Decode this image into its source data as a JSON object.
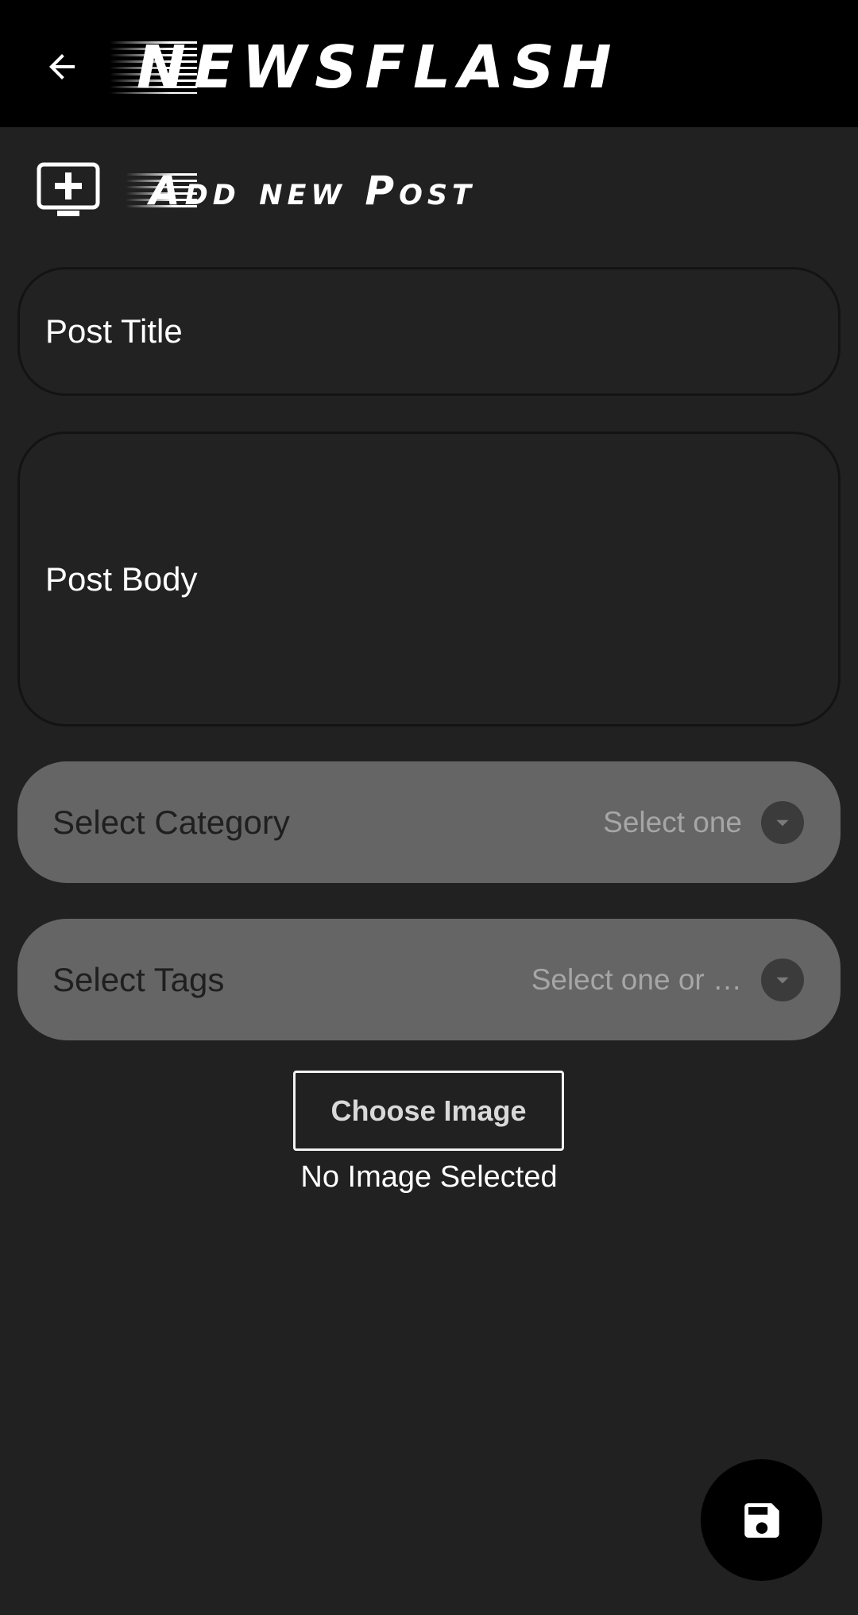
{
  "appbar": {
    "back_icon": "arrow-left-icon",
    "logo_text": "NEWSFLASH"
  },
  "section": {
    "icon": "monitor-add-icon",
    "title": "Add new Post"
  },
  "form": {
    "title_placeholder": "Post Title",
    "body_placeholder": "Post Body",
    "category": {
      "label": "Select Category",
      "value": "Select one",
      "icon": "dropdown-arrow-icon"
    },
    "tags": {
      "label": "Select Tags",
      "value": "Select one or …",
      "icon": "dropdown-arrow-icon"
    },
    "choose_image_label": "Choose Image",
    "image_status": "No Image Selected"
  },
  "fab": {
    "icon": "save-icon"
  },
  "colors": {
    "background": "#212121",
    "appbar": "#000000",
    "dropdown": "#656565",
    "fab": "#000000"
  }
}
